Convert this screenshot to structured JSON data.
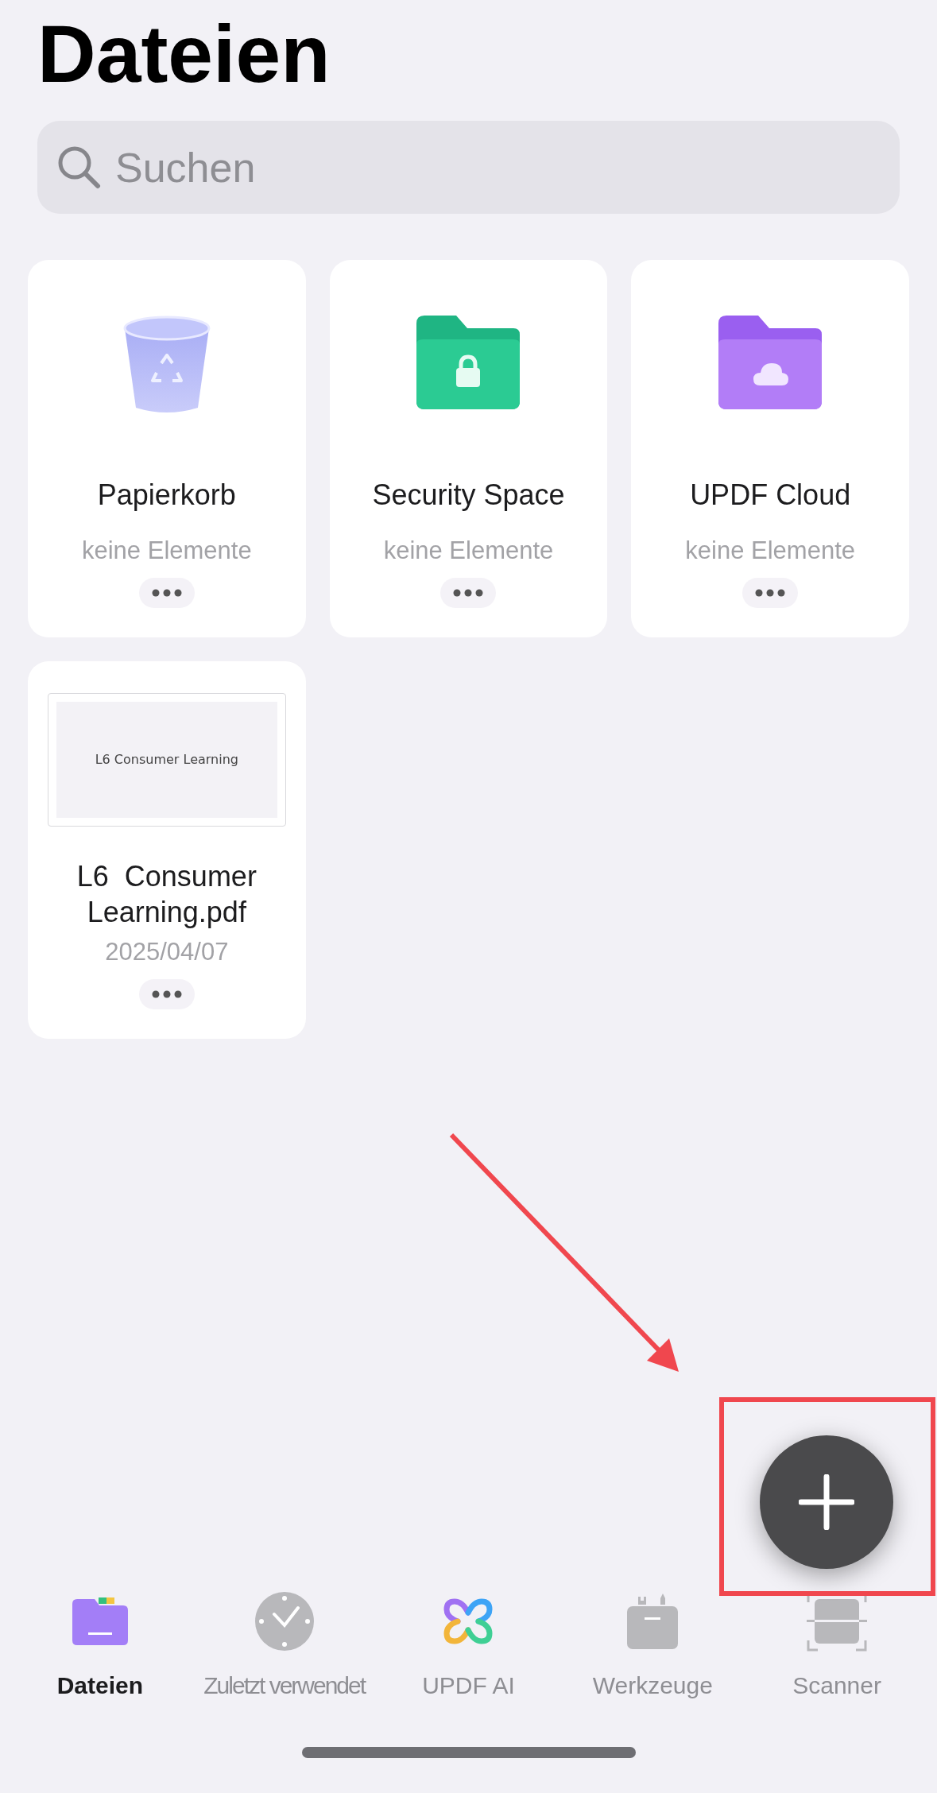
{
  "title": "Dateien",
  "search": {
    "placeholder": "Suchen"
  },
  "items": [
    {
      "kind": "trash",
      "name": "Papierkorb",
      "detail": "keine Elemente"
    },
    {
      "kind": "secure_folder",
      "name": "Security Space",
      "detail": "keine Elemente"
    },
    {
      "kind": "cloud_folder",
      "name": "UPDF Cloud",
      "detail": "keine Elemente"
    },
    {
      "kind": "document",
      "name": "L6  Consumer Learning.pdf",
      "detail": "2025/04/07",
      "preview_text": "L6 Consumer Learning"
    }
  ],
  "tab_bar": [
    {
      "kind": "files",
      "label": "Dateien",
      "selected": true
    },
    {
      "kind": "recent",
      "label": "Zuletzt verwendet",
      "selected": false
    },
    {
      "kind": "ai",
      "label": "UPDF AI",
      "selected": false
    },
    {
      "kind": "tools",
      "label": "Werkzeuge",
      "selected": false
    },
    {
      "kind": "scanner",
      "label": "Scanner",
      "selected": false
    }
  ]
}
